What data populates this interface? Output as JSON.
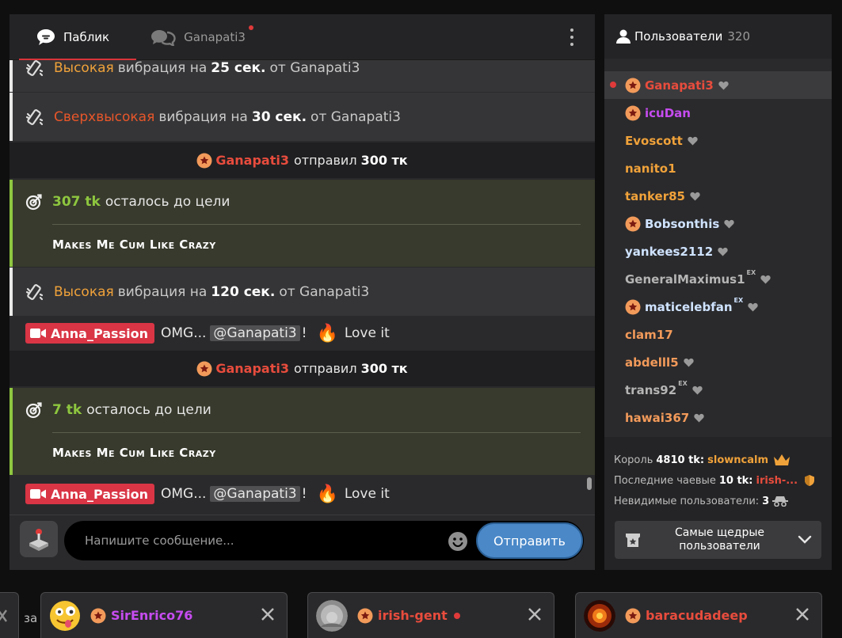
{
  "colors": {
    "orange": "#f0a23a",
    "red_orange": "#e8562a",
    "green": "#8ec63f",
    "red": "#e84c3d",
    "purple": "#c64cf0",
    "blue_light": "#cfe3ff",
    "peach": "#f29a5a",
    "accent_blue": "#4a88c8"
  },
  "chat": {
    "tabs": [
      {
        "label": "Паблик",
        "icon": "public-chat-icon",
        "active": true
      },
      {
        "label": "Ganapati3",
        "icon": "private-chat-icon",
        "active": false,
        "notification": true
      }
    ],
    "messages": {
      "vib1": {
        "level": "Высокая",
        "text1": "вибрация на",
        "duration": "25 сек.",
        "text2": "от Ganapati3"
      },
      "vib2": {
        "level": "Сверхвысокая",
        "text1": "вибрация на",
        "duration": "30 сек.",
        "text2": "от Ganapati3"
      },
      "tip1": {
        "user": "Ganapati3",
        "text": "отправил",
        "amount": "300 тк"
      },
      "goal1": {
        "remaining": "307 tk",
        "text": "осталось до цели",
        "title": "Makes Me Cum Like Crazy"
      },
      "vib3": {
        "level": "Высокая",
        "text1": "вибрация на",
        "duration": "120 сек.",
        "text2": "от Ganapati3"
      },
      "user1": {
        "user": "Anna_Passion",
        "text": "OMG...",
        "mention": "@Ganapati3",
        "bang": "!",
        "emoji": "🔥",
        "text2": "Love it"
      },
      "tip2": {
        "user": "Ganapati3",
        "text": "отправил",
        "amount": "300 тк"
      },
      "goal2": {
        "remaining": "7 tk",
        "text": "осталось до цели",
        "title": "Makes Me Cum Like Crazy"
      },
      "user2": {
        "user": "Anna_Passion",
        "text": "OMG...",
        "mention": "@Ganapati3",
        "bang": "!",
        "emoji": "🔥",
        "text2": "Love it"
      }
    },
    "input": {
      "placeholder": "Напишите сообщение...",
      "value": ""
    },
    "send_label": "Отправить"
  },
  "users": {
    "title": "Пользователи",
    "count": "320",
    "list": [
      {
        "name": "Ganapati3",
        "color": "#e84c3d",
        "coin": true,
        "heart": true,
        "ex": "",
        "live": true,
        "selected": true
      },
      {
        "name": "icuDan",
        "color": "#c64cf0",
        "coin": true,
        "heart": false,
        "ex": ""
      },
      {
        "name": "Evoscott",
        "color": "#f0a23a",
        "coin": false,
        "heart": true,
        "ex": ""
      },
      {
        "name": "nanito1",
        "color": "#f0a23a",
        "coin": false,
        "heart": false,
        "ex": ""
      },
      {
        "name": "tanker85",
        "color": "#f0a23a",
        "coin": false,
        "heart": true,
        "ex": ""
      },
      {
        "name": "Bobsonthis",
        "color": "#cfe3ff",
        "coin": true,
        "heart": true,
        "ex": ""
      },
      {
        "name": "yankees2112",
        "color": "#cfe3ff",
        "coin": false,
        "heart": true,
        "ex": ""
      },
      {
        "name": "GeneralMaximus1",
        "color": "#b5b5b5",
        "coin": false,
        "heart": true,
        "ex": "EX"
      },
      {
        "name": "maticelebfan",
        "color": "#cfe3ff",
        "coin": true,
        "heart": true,
        "ex": "EX"
      },
      {
        "name": "clam17",
        "color": "#f29a5a",
        "coin": false,
        "heart": false,
        "ex": ""
      },
      {
        "name": "abdelll5",
        "color": "#f29a5a",
        "coin": false,
        "heart": true,
        "ex": ""
      },
      {
        "name": "trans92",
        "color": "#b5b5b5",
        "coin": false,
        "heart": true,
        "ex": "EX"
      },
      {
        "name": "hawai367",
        "color": "#f29a5a",
        "coin": false,
        "heart": true,
        "ex": ""
      }
    ],
    "stats": {
      "king_label": "Король",
      "king_amount": "4810 tk:",
      "king_name": "slowncalm",
      "tips_label": "Последние чаевые",
      "tips_amount": "10 tk:",
      "tips_name": "irish-...",
      "invisible_label": "Невидимые пользователи:",
      "invisible_count": "3"
    },
    "generous_label": "Самые щедрые пользователи"
  },
  "bottom": {
    "stub_text": "за",
    "tabs": [
      {
        "name": "SirEnrico76",
        "color": "#c64cf0",
        "avatar": "emoji-avatar",
        "live": false
      },
      {
        "name": "irish-gent",
        "color": "#e84c3d",
        "avatar": "photo-avatar",
        "live": true
      },
      {
        "name": "baracudadeep",
        "color": "#e84c3d",
        "avatar": "fire-avatar",
        "live": false
      }
    ]
  }
}
